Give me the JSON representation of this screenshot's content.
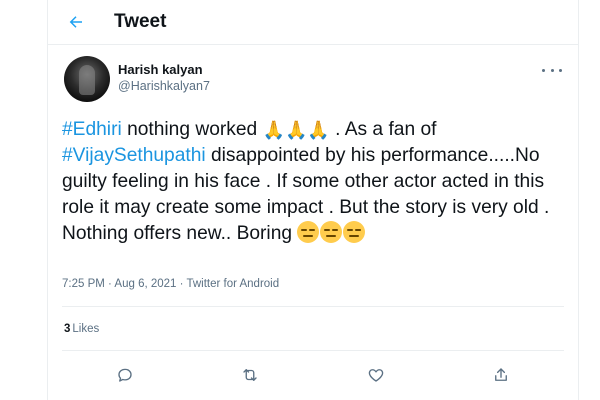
{
  "header": {
    "title": "Tweet",
    "back_icon": "back-arrow-icon",
    "accent": "#1da1f2"
  },
  "tweet": {
    "author_name": "Harish kalyan",
    "author_handle": "@Harishkalyan7",
    "hashtag_1": "#Edhiri",
    "text_1": " nothing worked ",
    "pray_emojis": "🙏🙏🙏",
    "text_2": " . As a fan of ",
    "hashtag_2": "#VijaySethupathi",
    "text_3": "  disappointed by his performance.....No guilty feeling in his face  . If some other actor acted in this role it may create some impact . But the story is very old . Nothing offers new.. Boring ",
    "expressionless_emoji_count": 3,
    "timestamp": "7:25 PM · Aug 6, 2021 · Twitter for Android",
    "likes_count": "3",
    "likes_label": "Likes",
    "hashtag_color": "#1b95e0"
  },
  "actions": [
    {
      "name": "reply",
      "icon": "reply-icon"
    },
    {
      "name": "retweet",
      "icon": "retweet-icon"
    },
    {
      "name": "like",
      "icon": "heart-icon"
    },
    {
      "name": "share",
      "icon": "share-icon"
    }
  ]
}
